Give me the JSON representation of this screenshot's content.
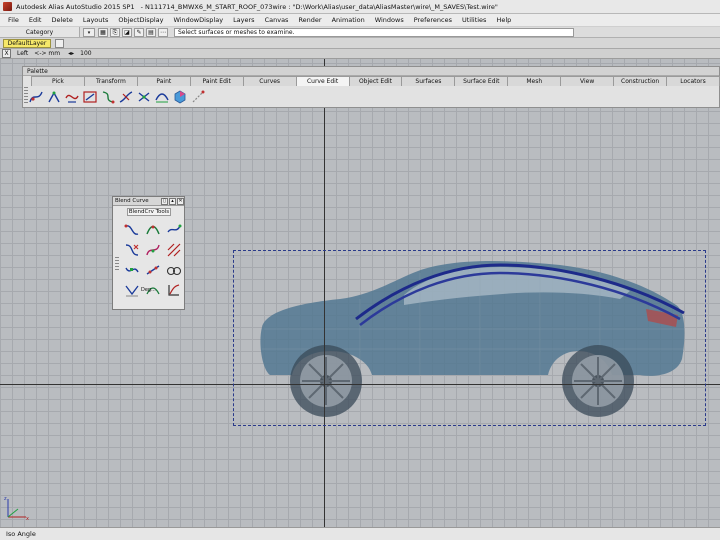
{
  "titlebar": {
    "app": "Autodesk Alias AutoStudio 2015 SP1",
    "document": "- N111714_BMWX6_M_START_ROOF_073wire : \"D:\\Work\\Alias\\user_data\\AliasMaster\\wire\\_M_SAVES\\Test.wire\""
  },
  "menu": [
    "File",
    "Edit",
    "Delete",
    "Layouts",
    "ObjectDisplay",
    "WindowDisplay",
    "Layers",
    "Canvas",
    "Render",
    "Animation",
    "Windows",
    "Preferences",
    "Utilities",
    "Help"
  ],
  "shelf": {
    "category_label": "Category",
    "prompt": "Select surfaces or meshes to examine."
  },
  "layer": {
    "default_layer": "DefaultLayer"
  },
  "view": {
    "close": "X",
    "name": "Left",
    "units": "<-> mm",
    "zoom": "100"
  },
  "palette": {
    "title": "Palette",
    "tabs": [
      "Pick",
      "Transform",
      "Paint",
      "Paint Edit",
      "Curves",
      "Curve Edit",
      "Object Edit",
      "Surfaces",
      "Surface Edit",
      "Mesh",
      "View",
      "Construction",
      "Locators"
    ],
    "active_tab": "Curve Edit"
  },
  "blend_window": {
    "title": "Blend Curve",
    "tab": "BlendCrv Tools",
    "tool_caption": "Deg..."
  },
  "statusbar": {
    "text": "Iso Angle"
  },
  "colors": {
    "layer_chip": "#f6e86a",
    "curve": "#2c3a9a",
    "car_body": "#4f7590",
    "selection_box": "#2a3a8a"
  }
}
